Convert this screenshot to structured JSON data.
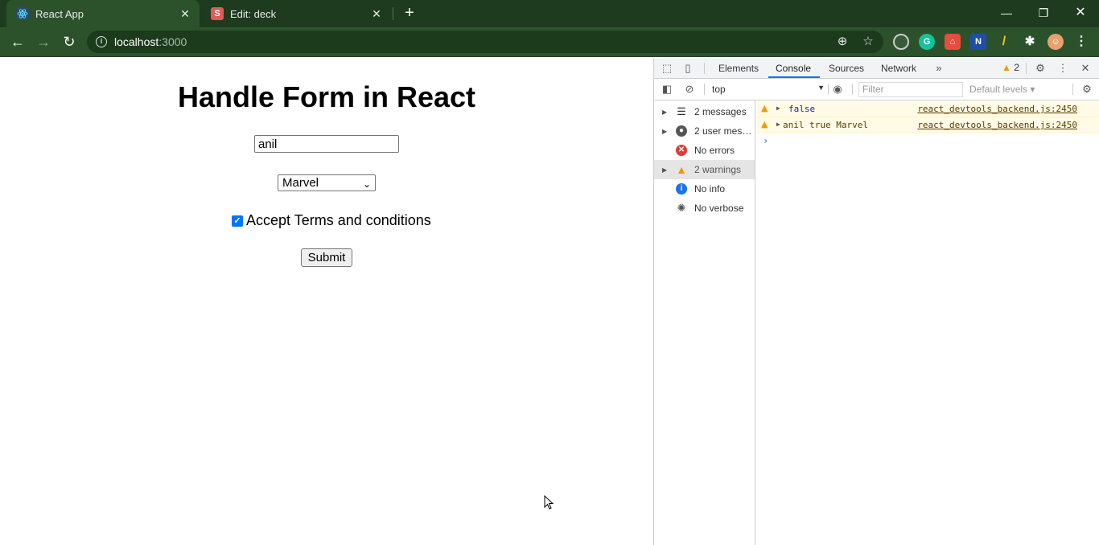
{
  "browser": {
    "tabs": [
      {
        "title": "React App",
        "favicon": "react-icon",
        "active": true
      },
      {
        "title": "Edit: deck",
        "favicon": "S",
        "active": false
      }
    ],
    "url_host": "localhost",
    "url_port": ":3000"
  },
  "page": {
    "heading": "Handle Form in React",
    "name_value": "anil",
    "select_value": "Marvel",
    "checkbox_checked": true,
    "checkbox_label": "Accept Terms and conditions",
    "submit_label": "Submit"
  },
  "devtools": {
    "tabs": [
      "Elements",
      "Console",
      "Sources",
      "Network"
    ],
    "active_tab": "Console",
    "warning_count": "2",
    "context": "top",
    "filter_placeholder": "Filter",
    "levels": "Default levels",
    "sidebar": [
      {
        "label": "2 messages",
        "icon": "list-icon"
      },
      {
        "label": "2 user mess...",
        "icon": "user-icon"
      },
      {
        "label": "No errors",
        "icon": "error-icon"
      },
      {
        "label": "2 warnings",
        "icon": "warning-icon"
      },
      {
        "label": "No info",
        "icon": "info-icon"
      },
      {
        "label": "No verbose",
        "icon": "bug-icon"
      }
    ],
    "messages": [
      {
        "text": "false",
        "source": "react_devtools_backend.js:2450"
      },
      {
        "text": "anil true Marvel",
        "source": "react_devtools_backend.js:2450"
      }
    ]
  }
}
